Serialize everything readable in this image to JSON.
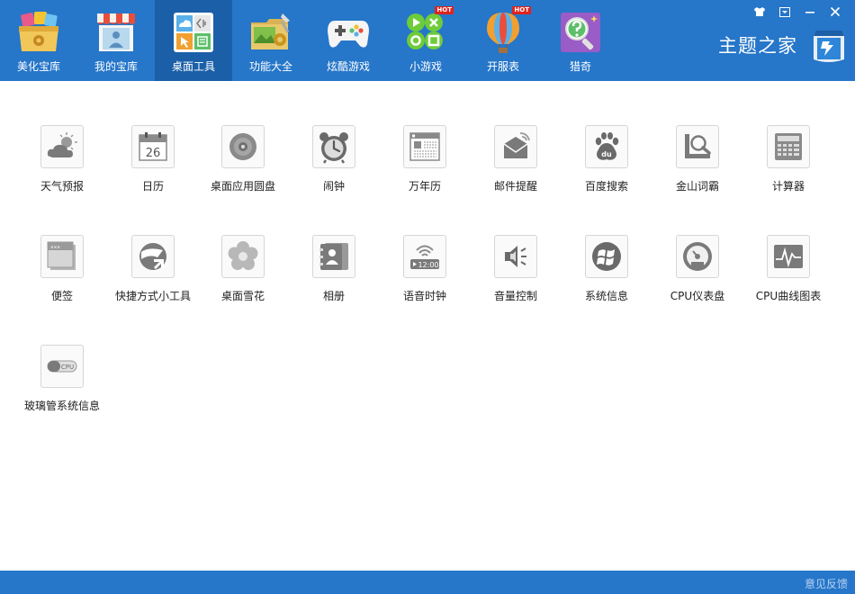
{
  "nav": {
    "items": [
      {
        "label": "美化宝库",
        "hot": ""
      },
      {
        "label": "我的宝库",
        "hot": ""
      },
      {
        "label": "桌面工具",
        "hot": ""
      },
      {
        "label": "功能大全",
        "hot": ""
      },
      {
        "label": "炫酷游戏",
        "hot": ""
      },
      {
        "label": "小游戏",
        "hot": "HOT"
      },
      {
        "label": "开服表",
        "hot": "HOT"
      },
      {
        "label": "猎奇",
        "hot": ""
      }
    ],
    "active_index": 2
  },
  "window": {
    "controls": [
      "skin-icon",
      "menu-icon",
      "minimize-icon",
      "close-icon"
    ]
  },
  "brand": {
    "text": "主题之家"
  },
  "tools": {
    "items": [
      {
        "label": "天气预报",
        "icon": "weather-icon"
      },
      {
        "label": "日历",
        "icon": "calendar-icon",
        "day": "26"
      },
      {
        "label": "桌面应用圆盘",
        "icon": "disc-icon"
      },
      {
        "label": "闹钟",
        "icon": "alarm-clock-icon"
      },
      {
        "label": "万年历",
        "icon": "perpetual-calendar-icon"
      },
      {
        "label": "邮件提醒",
        "icon": "mail-icon"
      },
      {
        "label": "百度搜索",
        "icon": "baidu-icon",
        "mark": "du"
      },
      {
        "label": "金山词霸",
        "icon": "dictionary-icon"
      },
      {
        "label": "计算器",
        "icon": "calculator-icon"
      },
      {
        "label": "便签",
        "icon": "sticky-note-icon",
        "mark": "×××"
      },
      {
        "label": "快捷方式小工具",
        "icon": "shortcut-icon"
      },
      {
        "label": "桌面雪花",
        "icon": "snowflake-icon"
      },
      {
        "label": "相册",
        "icon": "album-icon"
      },
      {
        "label": "语音时钟",
        "icon": "voice-clock-icon",
        "time": "12:00"
      },
      {
        "label": "音量控制",
        "icon": "volume-icon"
      },
      {
        "label": "系统信息",
        "icon": "windows-icon"
      },
      {
        "label": "CPU仪表盘",
        "icon": "cpu-gauge-icon"
      },
      {
        "label": "CPU曲线图表",
        "icon": "cpu-chart-icon"
      },
      {
        "label": "玻璃管系统信息",
        "icon": "glass-tube-icon",
        "mark": "CPU"
      }
    ]
  },
  "status": {
    "feedback": "意见反馈"
  },
  "colors": {
    "header": "#2676c9",
    "active_tab": "#1b5fa8",
    "icon_gray": "#7a7a7a",
    "hot": "#e0231e"
  }
}
